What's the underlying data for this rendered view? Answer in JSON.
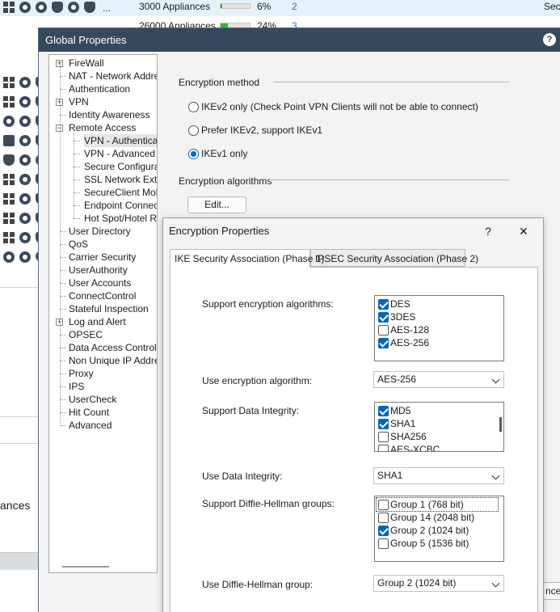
{
  "background": {
    "row1": {
      "label": "3000 Appliances",
      "percent": "6%",
      "progress": 0.06,
      "count": "2",
      "right_text": "Sec",
      "ellipsis": "..."
    },
    "row2": {
      "label": "26000 Appliances",
      "percent": "24%",
      "progress": 0.24,
      "count": "3"
    },
    "left_text": "ances",
    "right_fragment": "nce"
  },
  "global_properties": {
    "title": "Global Properties",
    "help": "?",
    "tree": [
      {
        "label": "FireWall",
        "expander": "+"
      },
      {
        "label": "NAT - Network Address Translation"
      },
      {
        "label": "Authentication"
      },
      {
        "label": "VPN",
        "expander": "+"
      },
      {
        "label": "Identity Awareness"
      },
      {
        "label": "Remote Access",
        "expander": "−"
      },
      {
        "label": "VPN - Authentication and Encryption",
        "child": true,
        "selected": true
      },
      {
        "label": "VPN - Advanced",
        "child": true
      },
      {
        "label": "Secure Configuration Verification",
        "child": true
      },
      {
        "label": "SSL Network Extender",
        "child": true
      },
      {
        "label": "SecureClient Mobile",
        "child": true
      },
      {
        "label": "Endpoint Connect",
        "child": true
      },
      {
        "label": "Hot Spot/Hotel Registration",
        "child": true
      },
      {
        "label": "User Directory"
      },
      {
        "label": "QoS"
      },
      {
        "label": "Carrier Security"
      },
      {
        "label": "UserAuthority"
      },
      {
        "label": "User Accounts"
      },
      {
        "label": "ConnectControl"
      },
      {
        "label": "Stateful Inspection"
      },
      {
        "label": "Log and Alert",
        "expander": "+"
      },
      {
        "label": "OPSEC"
      },
      {
        "label": "Data Access Control"
      },
      {
        "label": "Non Unique IP Address Ranges"
      },
      {
        "label": "Proxy"
      },
      {
        "label": "IPS"
      },
      {
        "label": "UserCheck"
      },
      {
        "label": "Hit Count"
      },
      {
        "label": "Advanced"
      }
    ],
    "encryption_method_label": "Encryption method",
    "radio_options": [
      {
        "label": "IKEv2 only (Check Point VPN Clients will not be able to connect)",
        "checked": false
      },
      {
        "label": "Prefer IKEv2, support IKEv1",
        "checked": false
      },
      {
        "label": "IKEv1 only",
        "checked": true
      }
    ],
    "encryption_algorithms_label": "Encryption algorithms",
    "edit_button": "Edit..."
  },
  "encryption_properties": {
    "title": "Encryption Properties",
    "help": "?",
    "close": "✕",
    "tabs": [
      {
        "label": "IKE Security Association (Phase 1)",
        "active": true
      },
      {
        "label": "IPSEC Security Association (Phase 2)",
        "active": false
      }
    ],
    "support_enc_label": "Support encryption algorithms:",
    "support_enc": [
      {
        "label": "DES",
        "checked": true
      },
      {
        "label": "3DES",
        "checked": true
      },
      {
        "label": "AES-128",
        "checked": false
      },
      {
        "label": "AES-256",
        "checked": true
      }
    ],
    "use_enc_label": "Use encryption algorithm:",
    "use_enc_value": "AES-256",
    "support_integrity_label": "Support Data Integrity:",
    "support_integrity": [
      {
        "label": "MD5",
        "checked": true
      },
      {
        "label": "SHA1",
        "checked": true
      },
      {
        "label": "SHA256",
        "checked": false
      },
      {
        "label": "AES-XCBC",
        "checked": false
      }
    ],
    "use_integrity_label": "Use Data Integrity:",
    "use_integrity_value": "SHA1",
    "support_dh_label": "Support Diffie-Hellman groups:",
    "support_dh": [
      {
        "label": "Group 1 (768 bit)",
        "checked": false
      },
      {
        "label": "Group 14 (2048 bit)",
        "checked": false
      },
      {
        "label": "Group 2 (1024 bit)",
        "checked": true
      },
      {
        "label": "Group 5 (1536 bit)",
        "checked": false
      }
    ],
    "use_dh_label": "Use Diffie-Hellman group:",
    "use_dh_value": "Group 2 (1024 bit)"
  }
}
